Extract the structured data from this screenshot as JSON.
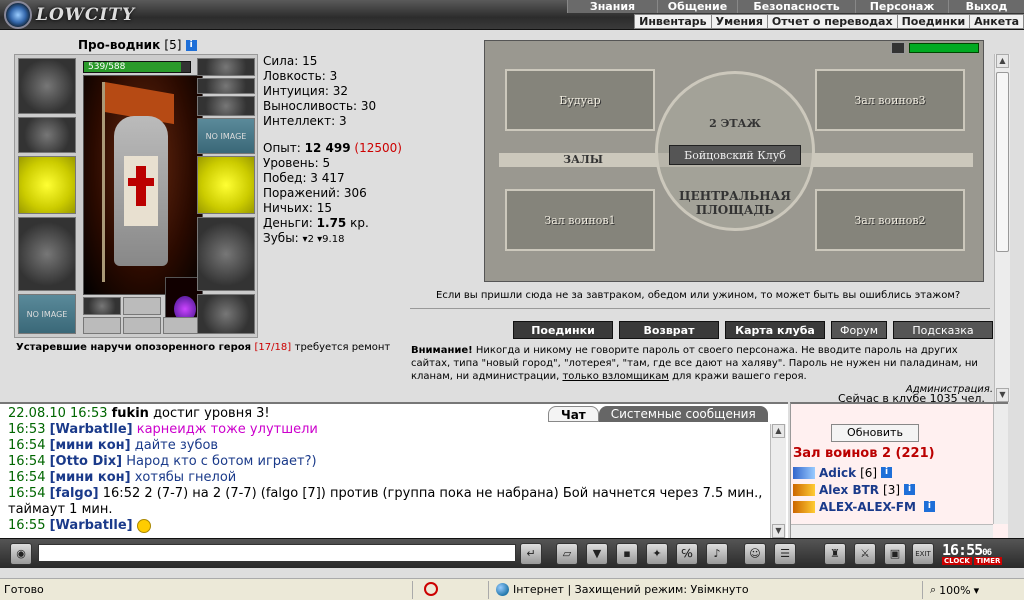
{
  "header": {
    "logo_text": "LOWCITY",
    "menu": [
      "Знания",
      "Общение",
      "Безопасность",
      "Персонаж",
      "Выход"
    ],
    "submenu": [
      "Инвентарь",
      "Умения",
      "Отчет о переводах",
      "Поединки",
      "Анкета"
    ]
  },
  "character": {
    "name": "Про-водник",
    "level": "[5]",
    "hp_text": "539/588",
    "hp_fraction": 0.917,
    "no_image_label": "NO IMAGE",
    "stats": [
      {
        "label": "Сила:",
        "value": "15"
      },
      {
        "label": "Ловкость:",
        "value": "3"
      },
      {
        "label": "Интуиция:",
        "value": "32"
      },
      {
        "label": "Выносливость:",
        "value": "30"
      },
      {
        "label": "Интеллект:",
        "value": "3"
      }
    ],
    "exp_label": "Опыт:",
    "exp_value": "12 499",
    "exp_next": "(12500)",
    "info_rows": [
      "Уровень: 5",
      "Побед: 3 417",
      "Поражений: 306",
      "Ничьих: 15"
    ],
    "money_label": "Деньги:",
    "money_value": "1.75",
    "money_unit": "кр.",
    "teeth_label": "Зубы:",
    "teeth_value": "2",
    "teeth_value2": "9.18",
    "repair_item": "Устаревшие наручи опозоренного героя",
    "repair_count": "[17/18]",
    "repair_note": "требуется ремонт"
  },
  "location": {
    "rooms": [
      "Будуар",
      "Зал воинов3",
      "Зал воинов1",
      "Зал воинов2"
    ],
    "floor": "2 ЭТАЖ",
    "halls": "ЗАЛЫ",
    "club": "Бойцовский Клуб",
    "square_line1": "ЦЕНТРАЛЬНАЯ",
    "square_line2": "ПЛОЩАДЬ",
    "note": "Если вы пришли сюда не за завтраком, обедом или ужином, то может быть вы ошиблись этажом?"
  },
  "nav_buttons": [
    "Поединки",
    "Возврат",
    "Карта клуба",
    "Форум",
    "Подсказка"
  ],
  "warning": {
    "title": "Внимание!",
    "text_before": " Никогда и никому не говорите пароль от своего персонажа. Не вводите пароль на других сайтах, типа \"новый город\", \"лотерея\", \"там, где все дают на халяву\". Пароль не нужен ни паладинам, ни кланам, ни администрации, ",
    "link": "только взломщикам",
    "text_after": " для кражи вашего героя.",
    "signature": "Администрация.",
    "online": "Сейчас в клубе 1035 чел."
  },
  "chat": {
    "tabs": [
      "Чат",
      "Системные сообщения"
    ],
    "lines": [
      {
        "time": "22.08.10 16:53",
        "nick": "fukin",
        "text": "достиг уровня 3!"
      },
      {
        "time": "16:53",
        "nick": "[Warbatlle]",
        "text": "карнеидж тоже улутшели"
      },
      {
        "time": "16:54",
        "nick": "[мини кон]",
        "text": "дайте зубов"
      },
      {
        "time": "16:54",
        "nick": "[Otto Dix]",
        "text": "Народ кто с ботом играет?)"
      },
      {
        "time": "16:54",
        "nick": "[мини кон]",
        "text": "хотябы гнелой"
      },
      {
        "time": "16:54",
        "nick": "[falgo]",
        "text": "16:52 2 (7-7) на 2 (7-7) (falgo [7]) против (группа пока не набрана) Бой начнется через 7.5 мин., таймаут 1 мин."
      },
      {
        "time": "16:55",
        "nick": "[Warbatlle]",
        "text": ""
      }
    ]
  },
  "roomlist": {
    "refresh": "Обновить",
    "title": "Зал воинов 2 (221)",
    "players": [
      {
        "name": "Adick",
        "level": "[6]"
      },
      {
        "name": "Alex BTR",
        "level": "[3]"
      },
      {
        "name": "ALEX-ALEX-FM",
        "level": ""
      }
    ]
  },
  "toolbar": {
    "input_value": "",
    "clock": "16:55",
    "clock_sec": "06",
    "clock_label": "CLOCK",
    "timer_label": "TIMER",
    "exit_label": "EXIT"
  },
  "statusbar": {
    "ready": "Готово",
    "zone": "Інтернет | Захищений режим: Увімкнуто",
    "zoom": "100%"
  }
}
